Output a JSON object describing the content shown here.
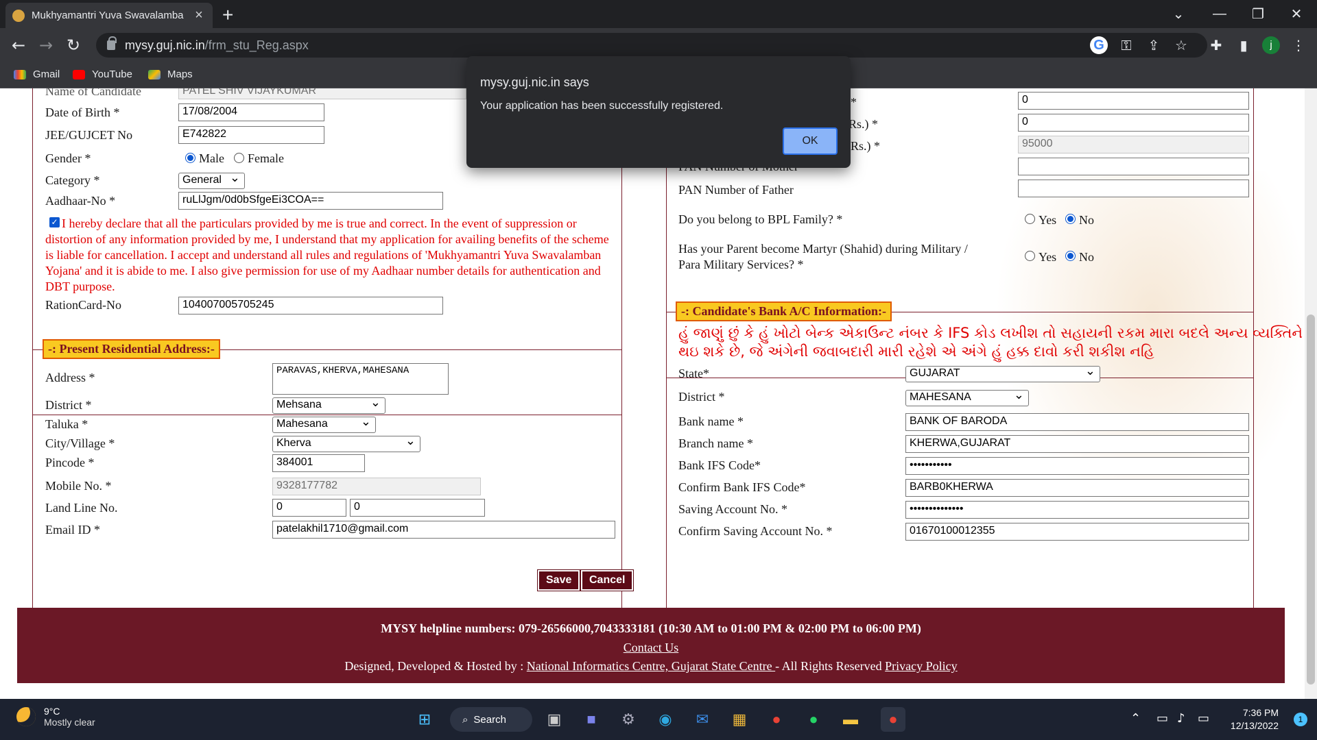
{
  "browser": {
    "tab_title": "Mukhyamantri Yuva Swavalamba",
    "url_domain": "mysy.guj.nic.in",
    "url_path": "/frm_stu_Reg.aspx",
    "avatar_letter": "j",
    "bookmarks": [
      "Gmail",
      "YouTube",
      "Maps"
    ]
  },
  "dialog": {
    "title": "mysy.guj.nic.in says",
    "message": "Your application has been successfully registered.",
    "ok_label": "OK"
  },
  "candidate": {
    "name_label": "Name of Candidate",
    "name_value": "PATEL SHIV VIJAYKUMAR",
    "dob_label": "Date of Birth *",
    "dob_value": "17/08/2004",
    "jee_label": "JEE/GUJCET No",
    "jee_value": "E742822",
    "gender_label": "Gender *",
    "gender_male": "Male",
    "gender_female": "Female",
    "gender_selected": "Male",
    "category_label": "Category *",
    "category_value": "General",
    "aadhaar_label": "Aadhaar-No *",
    "aadhaar_value": "ruLlJgm/0d0bSfgeEi3COA==",
    "declaration_checked": true,
    "declaration": "I hereby declare that all the particulars provided by me is true and correct. In the event of suppression or distortion of any information provided by me, I understand that my application for availing benefits of the scheme is liable for cancellation. I accept and understand all rules and regulations of 'Mukhyamantri Yuva Swavalamban Yojana' and it is abide to me. I also give permission for use of my Aadhaar number details for authentication and DBT purpose.",
    "ration_label": "RationCard-No",
    "ration_value": "104007005705245"
  },
  "address": {
    "legend": "-: Present Residential Address:-",
    "address_label": "Address *",
    "address_value": "PARAVAS,KHERVA,MAHESANA",
    "district_label": "District *",
    "district_value": "Mehsana",
    "taluka_label": "Taluka *",
    "taluka_value": "Mahesana",
    "city_label": "City/Village *",
    "city_value": "Kherva",
    "pincode_label": "Pincode *",
    "pincode_value": "384001",
    "mobile_label": "Mobile No. *",
    "mobile_value": "9328177782",
    "landline_label": "Land Line No.",
    "landline_std": "0",
    "landline_no": "0",
    "email_label": "Email ID *",
    "email_value": "patelakhil1710@gmail.com"
  },
  "family": {
    "row1_label_tail": "*",
    "row1_value": "0",
    "row2_label_tail": "Rs.) *",
    "row2_value": "0",
    "row3_label_tail": "Rs.) *",
    "row3_value": "95000",
    "pan_mother_label": "PAN Number of Mother",
    "pan_father_label": "PAN Number of Father",
    "bpl_label": "Do you belong to BPL Family? *",
    "martyr_label_1": "Has your Parent become Martyr (Shahid) during Military /",
    "martyr_label_2": "Para Military Services? *",
    "yes": "Yes",
    "no": "No"
  },
  "bank": {
    "legend": "-: Candidate's Bank A/C Information:-",
    "warning_1": "હું જાણું છું કે હું ખોટો બેન્ક એકાઉન્ટ નંબર કે IFS કોડ લખીશ તો સહાયની રકમ મારા બદલે અન્ય વ્યક્તિને",
    "warning_2": "થઇ શકે છે, જે અંગેની જવાબદારી મારી રહેશે એ અંગે હું હક્ક દાવો કરી શકીશ નહિ",
    "state_label": "State*",
    "state_value": "GUJARAT",
    "district_label": "District *",
    "district_value": "MAHESANA",
    "bankname_label": "Bank name *",
    "bankname_value": "BANK OF BARODA",
    "branch_label": "Branch name *",
    "branch_value": "KHERWA,GUJARAT",
    "ifsc_label": "Bank IFS Code*",
    "ifsc_value": "•••••••••••",
    "confirm_ifsc_label": "Confirm Bank IFS Code*",
    "confirm_ifsc_value": "BARB0KHERWA",
    "account_label": "Saving Account No. *",
    "account_value": "••••••••••••••",
    "confirm_account_label": "Confirm Saving Account No. *",
    "confirm_account_value": "01670100012355"
  },
  "actions": {
    "save": "Save",
    "cancel": "Cancel"
  },
  "footer": {
    "helpline": "MYSY helpline numbers: 079-26566000,7043333181 (10:30 AM to 01:00 PM & 02:00 PM to 06:00 PM)",
    "contact": "Contact Us",
    "designed_by": "Designed, Developed & Hosted by : ",
    "nic": "National Informatics Centre, Gujarat State Centre ",
    "rights": " - All Rights Reserved ",
    "privacy": "Privacy Policy"
  },
  "taskbar": {
    "temp": "9°C",
    "weather": "Mostly clear",
    "search": "Search",
    "time": "7:36 PM",
    "date": "12/13/2022",
    "notifications": "1"
  },
  "colors": {
    "maroon": "#6b1826",
    "legend_bg": "#f9c921",
    "warning_red": "#e00000",
    "dialog_bg": "#292a2d"
  }
}
